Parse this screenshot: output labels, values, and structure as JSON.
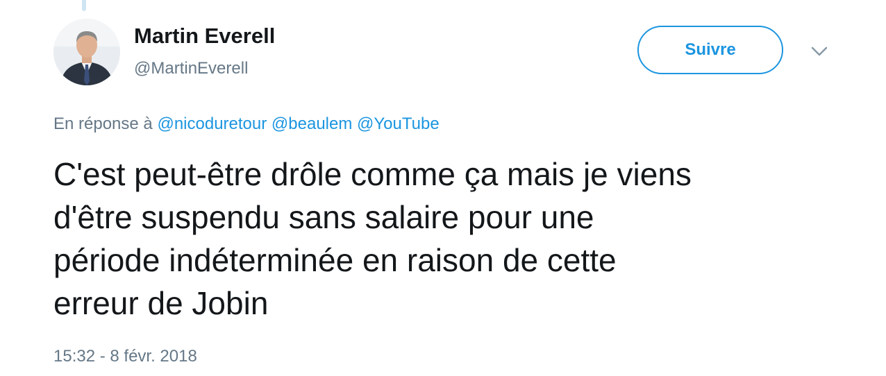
{
  "tweet": {
    "author": {
      "name": "Martin Everell",
      "handle": "@MartinEverell"
    },
    "follow_label": "Suivre",
    "reply_prefix": "En réponse à",
    "mentions": [
      "@nicoduretour",
      "@beaulem",
      "@YouTube"
    ],
    "text_lines": [
      "C'est peut-être drôle comme ça mais je viens",
      "d'être suspendu sans salaire pour une",
      "période indéterminée en raison de cette",
      "erreur de Jobin"
    ],
    "timestamp": "15:32 - 8 févr. 2018"
  },
  "colors": {
    "accent": "#1b95e0",
    "secondary_text": "#657786",
    "primary_text": "#14171a"
  },
  "icons": {
    "menu": "chevron-down-icon"
  }
}
